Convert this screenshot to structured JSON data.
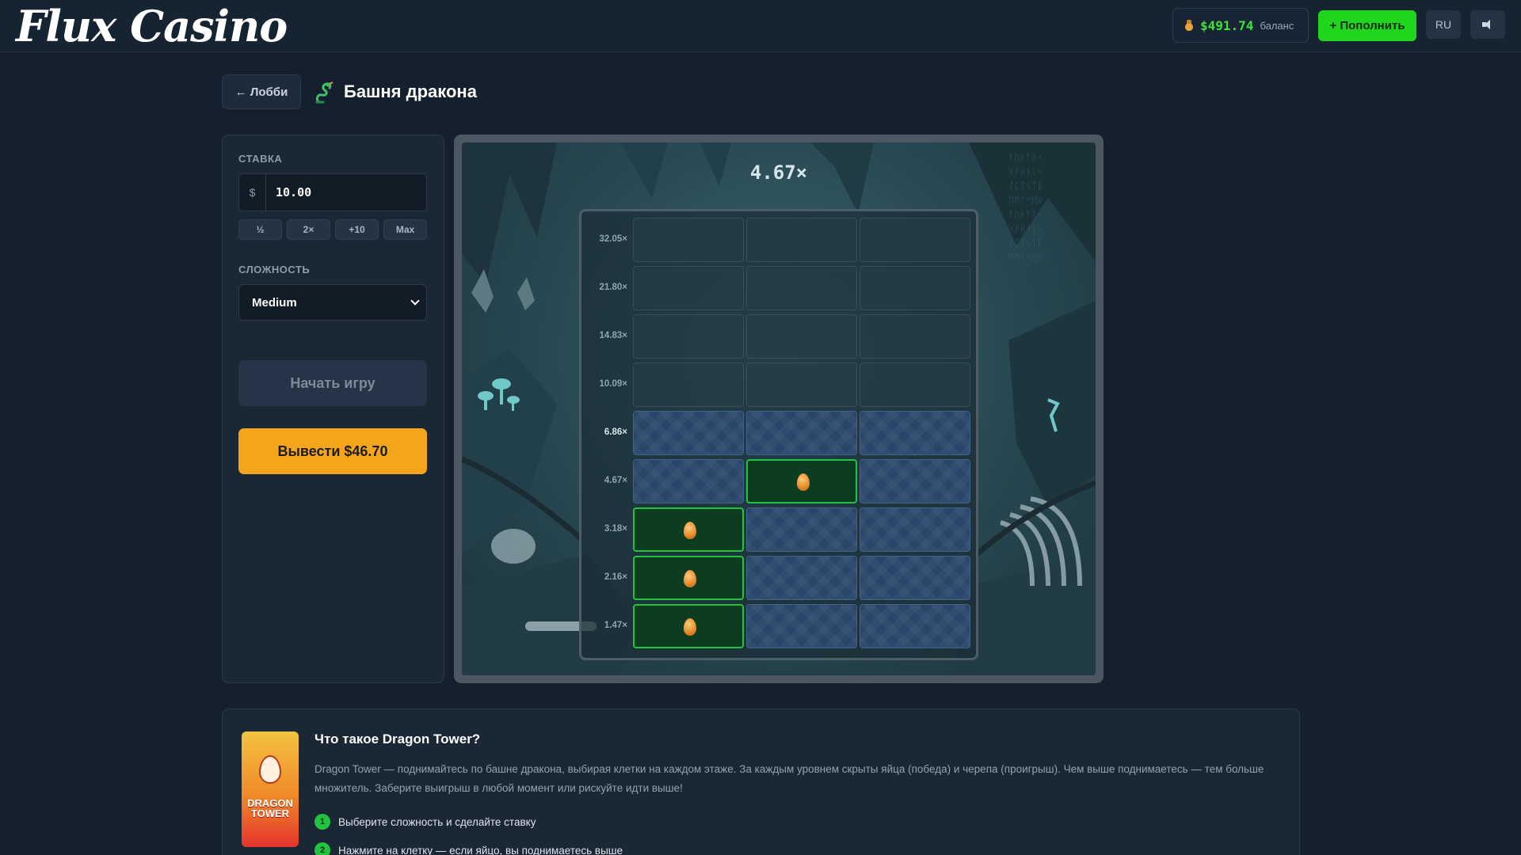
{
  "header": {
    "logo": "Flux Casino",
    "balance_amount": "$491.74",
    "balance_label": "баланс",
    "deposit_label": "+ Пополнить",
    "language": "RU",
    "icons": {
      "balance": "money-bag-icon",
      "sound": "speaker-icon"
    }
  },
  "title_bar": {
    "back_label": "← Лобби",
    "game_title": "Башня дракона",
    "icon": "dragon-icon"
  },
  "controls": {
    "bet_label": "СТАВКА",
    "bet_currency": "$",
    "bet_value": "10.00",
    "quick_buttons": [
      "½",
      "2×",
      "+10",
      "Max"
    ],
    "difficulty_label": "СЛОЖНОСТЬ",
    "difficulty_value": "Medium",
    "start_label": "Начать игру",
    "cashout_label": "Вывести $46.70"
  },
  "game": {
    "current_multiplier": "4.67×",
    "rows": [
      {
        "multiplier": "32.05×",
        "state": "locked",
        "cells": [
          "locked",
          "locked",
          "locked"
        ]
      },
      {
        "multiplier": "21.80×",
        "state": "locked",
        "cells": [
          "locked",
          "locked",
          "locked"
        ]
      },
      {
        "multiplier": "14.83×",
        "state": "locked",
        "cells": [
          "locked",
          "locked",
          "locked"
        ]
      },
      {
        "multiplier": "10.09×",
        "state": "locked",
        "cells": [
          "locked",
          "locked",
          "locked"
        ]
      },
      {
        "multiplier": "6.86×",
        "state": "active",
        "cells": [
          "open",
          "open",
          "open"
        ]
      },
      {
        "multiplier": "4.67×",
        "state": "passed",
        "cells": [
          "open",
          "egg",
          "open"
        ]
      },
      {
        "multiplier": "3.18×",
        "state": "passed",
        "cells": [
          "egg",
          "open",
          "open"
        ]
      },
      {
        "multiplier": "2.16×",
        "state": "passed",
        "cells": [
          "egg",
          "open",
          "open"
        ]
      },
      {
        "multiplier": "1.47×",
        "state": "passed",
        "cells": [
          "egg",
          "open",
          "open"
        ]
      }
    ],
    "colors": {
      "win_border": "#21c43e",
      "open_cell": "#29466a",
      "egg": "#e58a2a"
    }
  },
  "info": {
    "thumbnail_text": "DRAGON TOWER",
    "title": "Что такое Dragon Tower?",
    "description": "Dragon Tower — поднимайтесь по башне дракона, выбирая клетки на каждом этаже. За каждым уровнем скрыты яйца (победа) и черепа (проигрыш). Чем выше поднимаетесь — тем больше множитель. Заберите выигрыш в любой момент или рискуйте идти выше!",
    "steps": [
      {
        "num": "1",
        "text": "Выберите сложность и сделайте ставку"
      },
      {
        "num": "2",
        "text": "Нажмите на клетку — если яйцо, вы поднимаетесь выше"
      }
    ]
  }
}
